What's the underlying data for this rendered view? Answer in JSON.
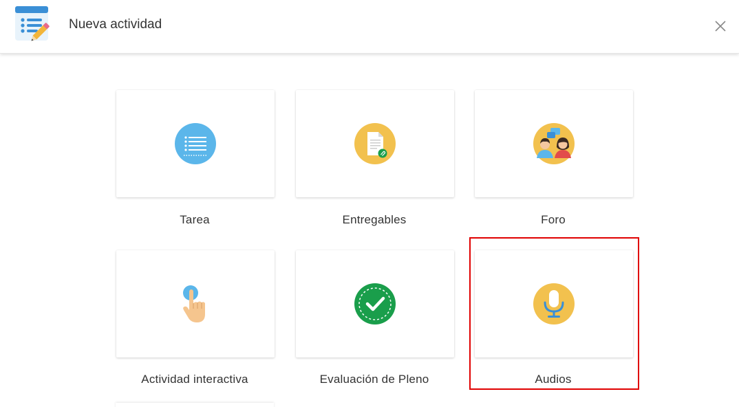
{
  "header": {
    "title": "Nueva actividad",
    "icon": "activity-list-edit-icon",
    "close_icon": "close-icon"
  },
  "activities": [
    {
      "label": "Tarea",
      "icon": "task-list-icon"
    },
    {
      "label": "Entregables",
      "icon": "document-attachment-icon"
    },
    {
      "label": "Foro",
      "icon": "forum-people-chat-icon"
    },
    {
      "label": "Actividad interactiva",
      "icon": "hand-pointer-icon"
    },
    {
      "label": "Evaluación de Pleno",
      "icon": "check-badge-icon"
    },
    {
      "label": "Audios",
      "icon": "microphone-icon",
      "highlighted": true
    }
  ],
  "colors": {
    "blue": "#5bb6ea",
    "yellow": "#f2c14e",
    "green": "#1a9e4b",
    "highlight": "#e00000"
  }
}
